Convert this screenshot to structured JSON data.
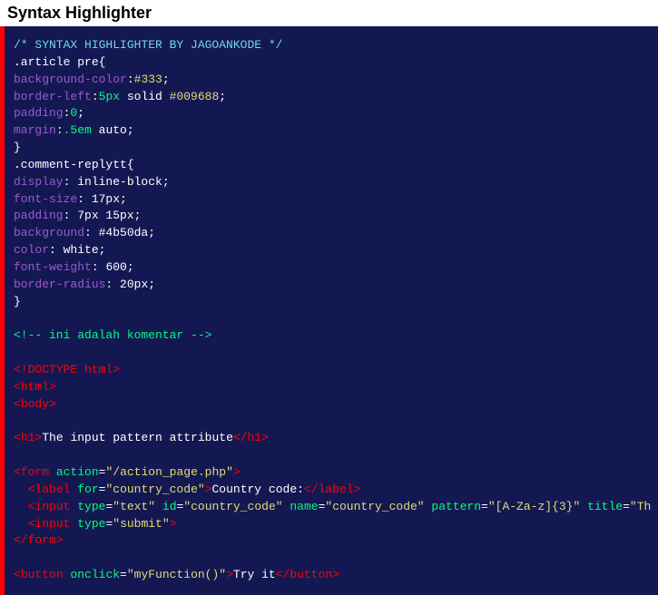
{
  "header": {
    "title": "Syntax Highlighter"
  },
  "code": {
    "line1": "/* SYNTAX HIGHLIGHTER BY JAGOANKODE */",
    "sel1": ".article pre{",
    "p_bgcolor": "background-color",
    "v_333": "#333",
    "p_borderleft": "border-left",
    "v_5px": "5px",
    "v_solid": " solid ",
    "v_009688": "#009688",
    "p_padding": "padding",
    "v_0": "0",
    "p_margin": "margin",
    "v_5em": ".5em",
    "v_auto": " auto",
    "brace_close": "}",
    "sel2": ".comment-replytt{",
    "p_display": "display",
    "v_inlineblock": " inline-block",
    "p_fontsize": "font-size",
    "v_17px": " 17px",
    "v_7px15px": " 7px 15px",
    "p_background": "background",
    "v_4b50da": " #4b50da",
    "p_color": "color",
    "v_white": " white",
    "p_fontweight": "font-weight",
    "v_600": " 600",
    "p_borderradius": "border-radius",
    "v_20px": " 20px",
    "html_comment": "<!-- ini adalah komentar -->",
    "doctype": "<!DOCTYPE html>",
    "tag_html": "html",
    "tag_body": "body",
    "tag_h1": "h1",
    "h1_text": "The input pattern attribute",
    "tag_form": "form",
    "attr_action": "action",
    "val_action": "\"/action_page.php\"",
    "tag_label": "label",
    "attr_for": "for",
    "val_for": "\"country_code\"",
    "label_text": "Country code:",
    "tag_input": "input",
    "attr_type": "type",
    "val_text": "\"text\"",
    "attr_id": "id",
    "val_id": "\"country_code\"",
    "attr_name": "name",
    "val_name": "\"country_code\"",
    "attr_pattern": "pattern",
    "val_pattern": "\"[A-Za-z]{3}\"",
    "attr_title": "title",
    "val_title": "\"Th",
    "val_submit": "\"submit\"",
    "tag_button": "button",
    "attr_onclick": "onclick",
    "val_onclick": "\"myFunction()\"",
    "button_text": "Try it",
    "colon": ":",
    "semi": ";",
    "lt": "<",
    "gt": ">",
    "ltslash": "</",
    "eq": "="
  }
}
